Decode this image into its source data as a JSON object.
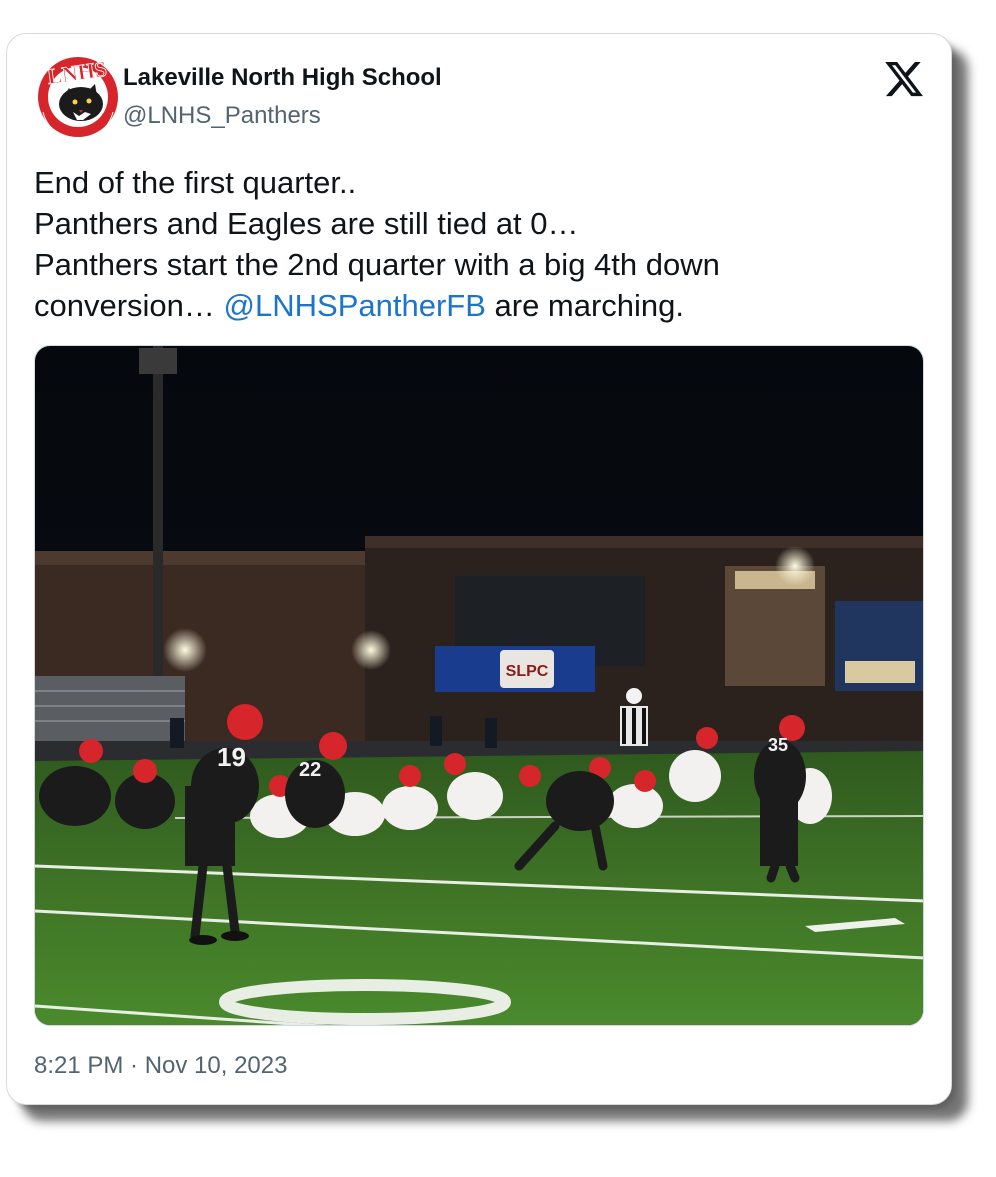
{
  "author": {
    "name": "Lakeville North High School",
    "handle": "@LNHS_Panthers",
    "avatar_icon": "lnhs-panther-logo",
    "avatar_text": "LNHS"
  },
  "tweet": {
    "line1": "End of the first quarter..",
    "line2": "Panthers and Eagles are still tied at 0…",
    "line3": "Panthers start the 2nd quarter with a big 4th down",
    "line4_prefix": "conversion… ",
    "mention": "@LNHSPantherFB",
    "line4_suffix": " are marching."
  },
  "media": {
    "kind": "photo",
    "scoreboard_sign": "SLPC",
    "jersey_numbers": [
      "19",
      "22",
      "35"
    ],
    "field_marking": "0"
  },
  "timestamp": "8:21 PM · Nov 10, 2023",
  "platform_icon": "x-logo-icon",
  "colors": {
    "text": "#0f1419",
    "secondary": "#536471",
    "link": "#1d75c9",
    "brand_red": "#d7262b"
  }
}
